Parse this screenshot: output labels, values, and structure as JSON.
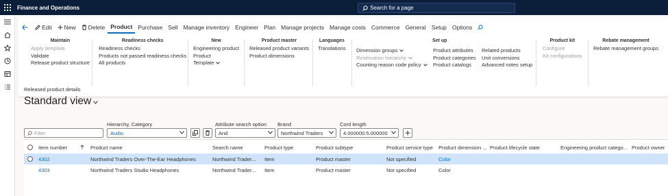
{
  "topbar": {
    "app_title": "Finance and Operations",
    "search_placeholder": "Search for a page"
  },
  "sidenav": {
    "icons": [
      "hamburger-icon",
      "home-icon",
      "star-icon",
      "recent-icon",
      "workspace-icon",
      "list-icon"
    ]
  },
  "action_bar": {
    "edit": "Edit",
    "new": "New",
    "delete": "Delete",
    "tabs": [
      "Product",
      "Purchase",
      "Sell",
      "Manage inventory",
      "Engineer",
      "Plan",
      "Manage projects",
      "Manage costs",
      "Commerce",
      "General",
      "Setup",
      "Options"
    ],
    "active_tab": "Product"
  },
  "groups": {
    "maintain": {
      "title": "Maintain",
      "items": [
        "Apply template",
        "Validate",
        "Release product structure"
      ]
    },
    "readiness": {
      "title": "Readiness checks",
      "items": [
        "Readiness checks",
        "Products not passed readiness checks",
        "All products"
      ]
    },
    "new": {
      "title": "New",
      "items": [
        "Engineering product",
        "Product",
        "Template"
      ]
    },
    "product_master": {
      "title": "Product master",
      "items": [
        "Released product variants",
        "Product dimensions"
      ]
    },
    "languages": {
      "title": "Languages",
      "items": [
        "Translations"
      ]
    },
    "setup_dims": {
      "items": [
        "Dimension groups",
        "Reservation hierarchy",
        "Counting reason code policy"
      ]
    },
    "setup": {
      "title": "Set up",
      "items": [
        "Product attributes",
        "Product categories",
        "Product catalogs"
      ]
    },
    "related": {
      "items": [
        "Related products",
        "Unit conversions",
        "Advanced notes setup"
      ]
    },
    "product_kit": {
      "title": "Product kit",
      "items": [
        "Configure",
        "Kit configurations"
      ]
    },
    "rebate": {
      "title": "Rebate management",
      "items": [
        "Rebate management groups"
      ]
    }
  },
  "page": {
    "breadcrumb": "Released product details",
    "view_title": "Standard view"
  },
  "filters": {
    "filter_placeholder": "Filter",
    "hierarchy_label": "Hierarchy, Category",
    "hierarchy_value": "Audio",
    "attr_label": "Attribute search option",
    "attr_value": "And",
    "brand_label": "Brand",
    "brand_value": "Northwind Traders",
    "cord_label": "Cord length",
    "cord_value": "4.000000:5.000000"
  },
  "grid": {
    "columns": [
      "Item number",
      "Product name",
      "Search name",
      "Product type",
      "Product subtype",
      "Product service type",
      "Product dimension ...",
      "Product lifecycle state",
      "Engineering product catego...",
      "Product owner"
    ],
    "rows": [
      [
        "4302",
        "Northwind Traders Over-The-Ear Headphones",
        "Northwind Trader...",
        "Item",
        "Product master",
        "Not specified",
        "Color",
        "",
        "",
        ""
      ],
      [
        "4303",
        "Northwind Traders Studio Headphones",
        "Northwind Trader...",
        "Item",
        "Product master",
        "Not specified",
        "Color",
        "",
        "",
        ""
      ]
    ]
  },
  "colors": {
    "topbar": "#0b1f3a",
    "accent": "#0f6cbd",
    "selected_row": "#cfe4fa"
  }
}
